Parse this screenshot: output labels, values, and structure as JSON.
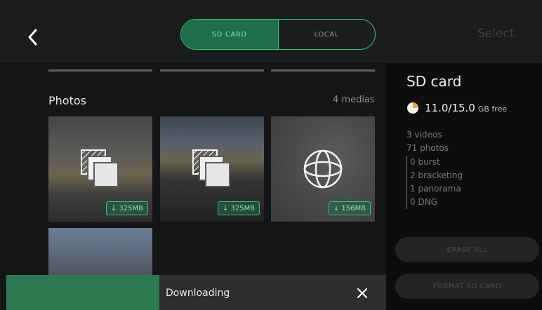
{
  "header": {
    "tabs": [
      {
        "label": "SD CARD",
        "active": true
      },
      {
        "label": "LOCAL",
        "active": false
      }
    ],
    "select_label": "Select"
  },
  "gallery": {
    "section_title": "Photos",
    "media_count": "4 medias",
    "items": [
      {
        "type": "burst",
        "icon": "stack-icon",
        "size": "↓ 325MB"
      },
      {
        "type": "burst",
        "icon": "stack-icon",
        "size": "↓ 325MB"
      },
      {
        "type": "panorama",
        "icon": "sphere-icon",
        "size": "↓ 156MB"
      },
      {
        "type": "photo",
        "icon": "",
        "size": ""
      }
    ]
  },
  "panel": {
    "title": "SD card",
    "storage_value": "11.0/15.0",
    "storage_unit": "GB free",
    "storage_used_fraction": 0.27,
    "videos": "3 videos",
    "photos": "71 photos",
    "breakdown": [
      "0 burst",
      "2 bracketing",
      "1 panorama",
      "0 DNG"
    ],
    "erase_label": "ERASE ALL",
    "format_label": "FORMAT SD CARD"
  },
  "download_bar": {
    "label": "Downloading",
    "progress": 0.4
  },
  "colors": {
    "accent": "#2ecc71",
    "panel_bg": "#0d0d0e",
    "progress_green": "#2d7a50",
    "storage_orange": "#f5a623"
  }
}
